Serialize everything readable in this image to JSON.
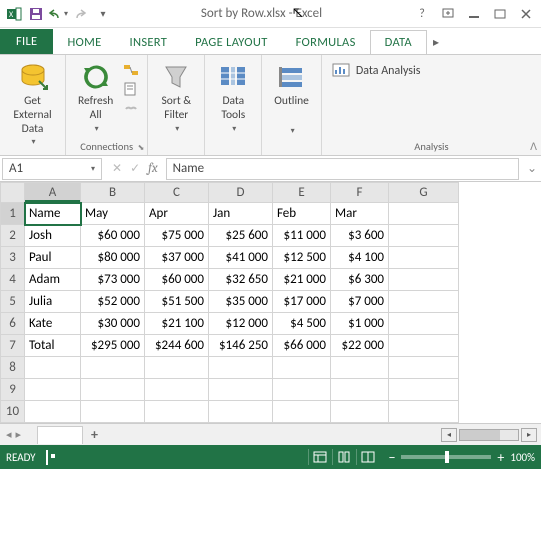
{
  "titlebar": {
    "title": "Sort by Row.xlsx - Excel"
  },
  "tabs": {
    "file": "FILE",
    "items": [
      "HOME",
      "INSERT",
      "PAGE LAYOUT",
      "FORMULAS",
      "DATA"
    ],
    "active_index": 4
  },
  "ribbon": {
    "get_external": "Get External\nData",
    "refresh": "Refresh\nAll",
    "connections_label": "Connections",
    "sort_filter": "Sort &\nFilter",
    "data_tools": "Data\nTools",
    "outline": "Outline",
    "data_analysis": "Data Analysis",
    "analysis_label": "Analysis"
  },
  "fbar": {
    "namebox": "A1",
    "formula": "Name"
  },
  "columns": [
    "A",
    "B",
    "C",
    "D",
    "E",
    "F",
    "G"
  ],
  "rowhdrs": [
    "1",
    "2",
    "3",
    "4",
    "5",
    "6",
    "7",
    "8",
    "9",
    "10"
  ],
  "cells": {
    "r1": [
      "Name",
      "May",
      "Apr",
      "Jan",
      "Feb",
      "Mar",
      ""
    ],
    "r2": [
      "Josh",
      "$60 000",
      "$75 000",
      "$25 600",
      "$11 000",
      "$3 600",
      ""
    ],
    "r3": [
      "Paul",
      "$80 000",
      "$37 000",
      "$41 000",
      "$12 500",
      "$4 100",
      ""
    ],
    "r4": [
      "Adam",
      "$73 000",
      "$60 000",
      "$32 650",
      "$21 000",
      "$6 300",
      ""
    ],
    "r5": [
      "Julia",
      "$52 000",
      "$51 500",
      "$35 000",
      "$17 000",
      "$7 000",
      ""
    ],
    "r6": [
      "Kate",
      "$30 000",
      "$21 100",
      "$12 000",
      "$4 500",
      "$1 000",
      ""
    ],
    "r7": [
      "Total",
      "$295 000",
      "$244 600",
      "$146 250",
      "$66 000",
      "$22 000",
      ""
    ]
  },
  "sheettabs": {
    "add": "+"
  },
  "status": {
    "ready": "READY",
    "zoom": "100%"
  }
}
